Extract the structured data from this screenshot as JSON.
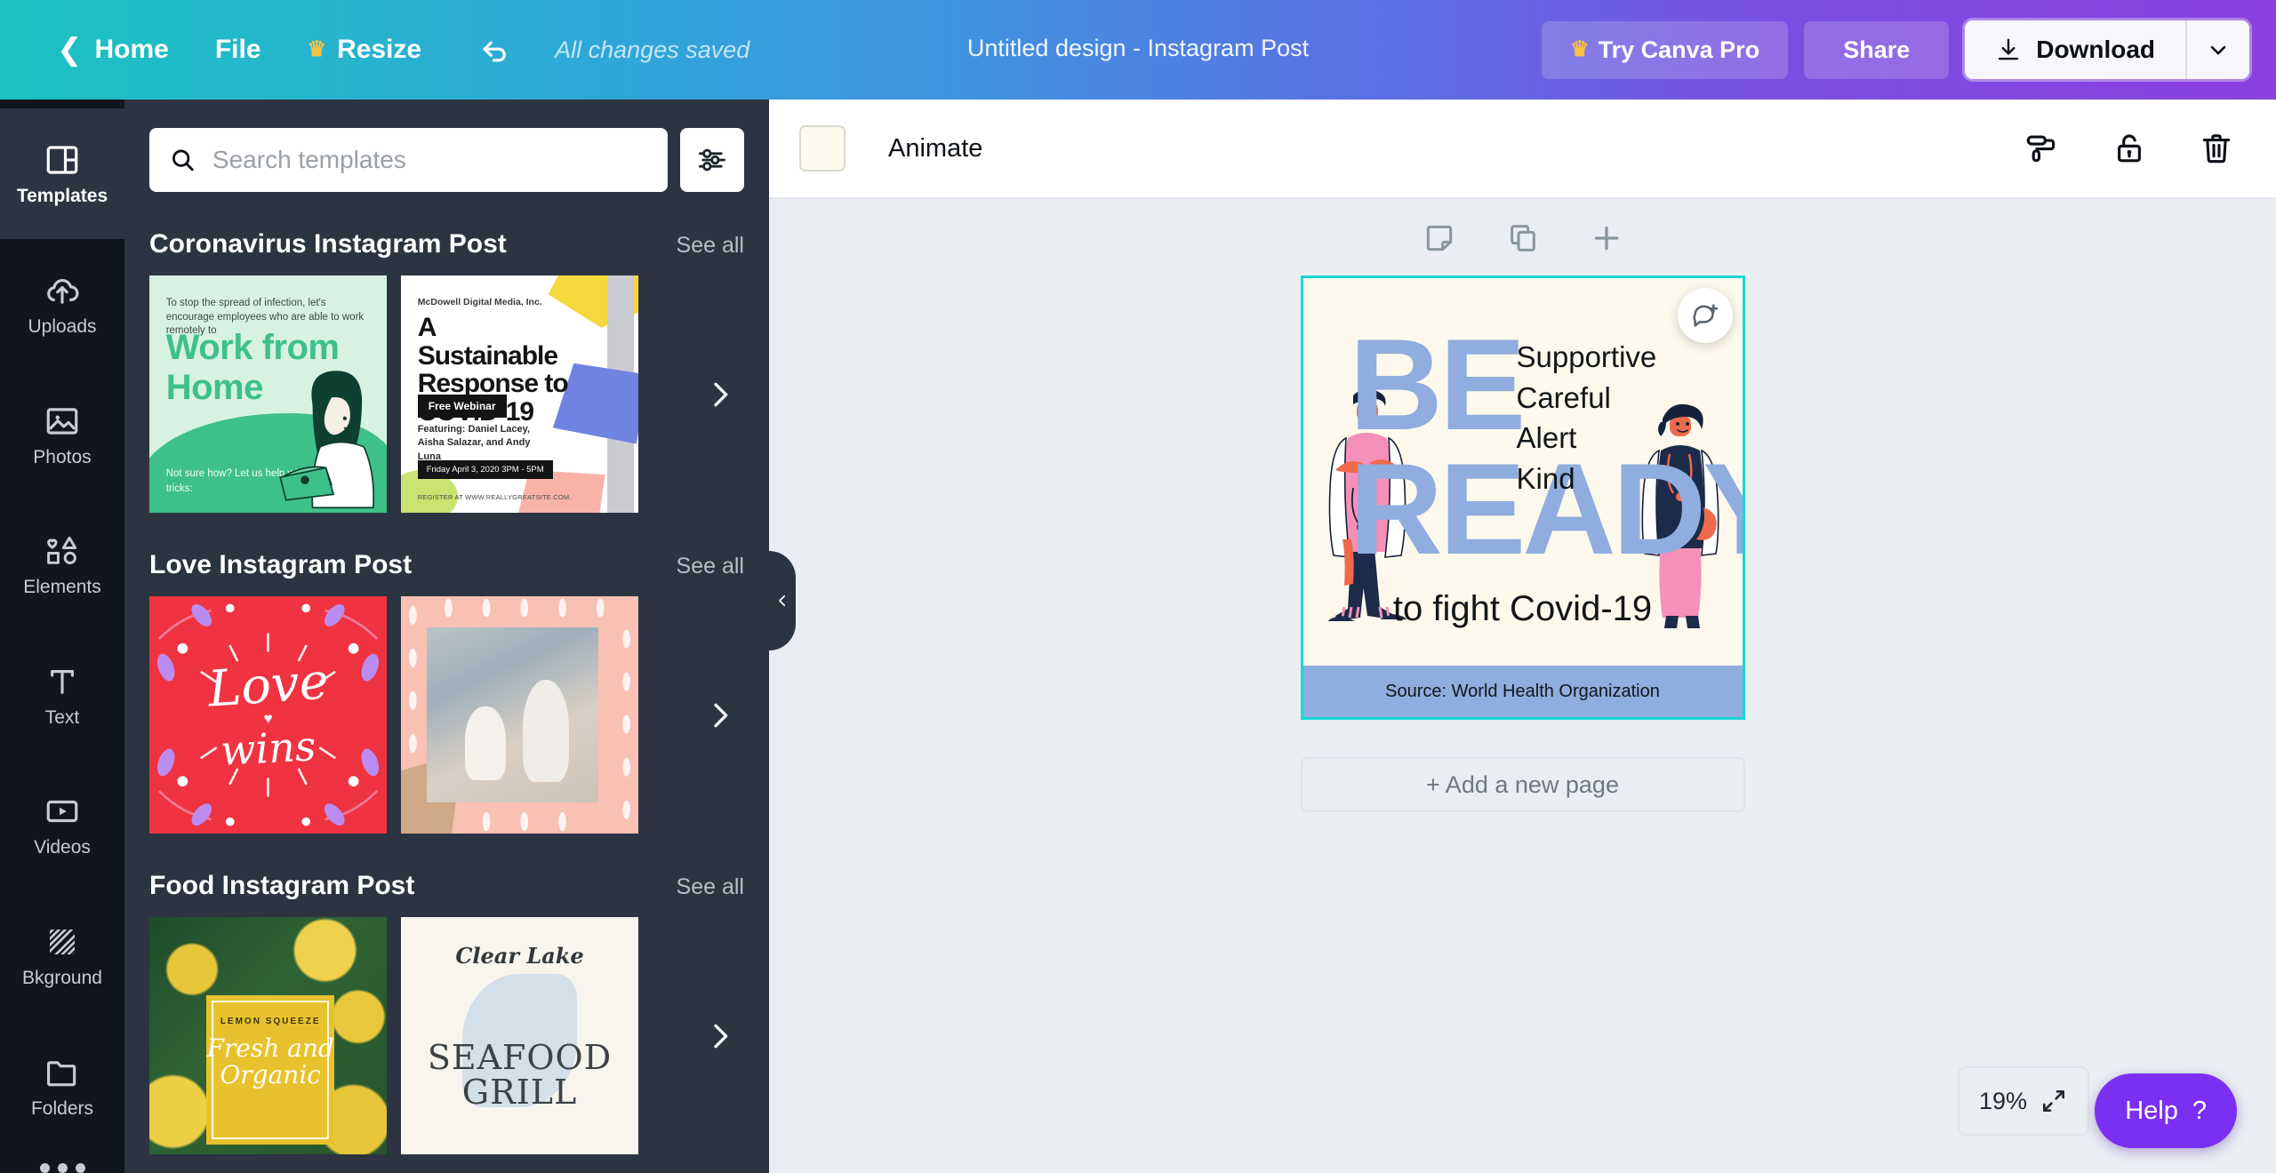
{
  "topbar": {
    "home": "Home",
    "file": "File",
    "resize": "Resize",
    "undo_icon": "undo-arrow-icon",
    "saved_status": "All changes saved",
    "design_title": "Untitled design - Instagram Post",
    "try_pro": "Try Canva Pro",
    "share": "Share",
    "download": "Download",
    "download_caret_icon": "chevron-down-icon",
    "crown_icon": "crown-icon",
    "back_icon": "chevron-left-icon"
  },
  "rail": {
    "items": [
      {
        "label": "Templates",
        "icon": "templates-icon",
        "active": true
      },
      {
        "label": "Uploads",
        "icon": "cloud-upload-icon",
        "active": false
      },
      {
        "label": "Photos",
        "icon": "image-icon",
        "active": false
      },
      {
        "label": "Elements",
        "icon": "shapes-icon",
        "active": false
      },
      {
        "label": "Text",
        "icon": "text-t-icon",
        "active": false
      },
      {
        "label": "Videos",
        "icon": "video-play-icon",
        "active": false
      },
      {
        "label": "Bkground",
        "icon": "hatch-pattern-icon",
        "active": false
      },
      {
        "label": "Folders",
        "icon": "folder-icon",
        "active": false
      }
    ],
    "more_icon": "more-dots-icon"
  },
  "panel": {
    "search": {
      "placeholder": "Search templates",
      "value": "",
      "search_icon": "search-icon",
      "filter_icon": "sliders-filter-icon"
    },
    "collapse_icon": "chevron-left-icon",
    "see_all_label": "See all",
    "next_icon": "chevron-right-icon",
    "sections": [
      {
        "title": "Coronavirus Instagram Post",
        "templates": [
          {
            "name": "work-from-home",
            "subtitle": "To stop the spread of infection, let's encourage employees who are able to work remotely to",
            "title": "Work from Home",
            "footer": "Not sure how? Let us help with a few tips and tricks:"
          },
          {
            "name": "sustainable-response",
            "brand": "McDowell Digital Media, Inc.",
            "title": "A Sustainable Response to COVID-19",
            "pill": "Free Webinar",
            "featuring": "Featuring: Daniel Lacey, Aisha Salazar, and Andy Luna",
            "date": "Friday April 3, 2020 3PM - 5PM",
            "register": "REGISTER AT WWW.REALLYGREATSITE.COM."
          }
        ]
      },
      {
        "title": "Love Instagram Post",
        "templates": [
          {
            "name": "love-wins",
            "word1": "Love",
            "word2": "wins",
            "heart": "♥"
          },
          {
            "name": "babies-photo"
          }
        ]
      },
      {
        "title": "Food Instagram Post",
        "templates": [
          {
            "name": "lemon-squeeze",
            "kicker": "LEMON SQUEEZE",
            "title": "Fresh and Organic"
          },
          {
            "name": "seafood-grill",
            "brand": "Clear Lake",
            "title": "SEAFOOD GRILL"
          }
        ]
      }
    ]
  },
  "editor": {
    "toolbar": {
      "color_swatch": "#fdfaee",
      "animate_label": "Animate",
      "paint_roller_icon": "paint-roller-icon",
      "lock_icon": "unlocked-padlock-icon",
      "trash_icon": "trash-can-icon"
    },
    "page_tools": {
      "notes_icon": "sticky-note-icon",
      "duplicate_icon": "duplicate-page-icon",
      "add_icon": "plus-icon"
    },
    "comment_icon": "add-comment-icon",
    "add_page_label": "+ Add a new page",
    "zoom_level": "19%",
    "expand_icon": "expand-arrows-icon",
    "help_label": "Help",
    "help_mark": "?"
  },
  "design": {
    "be": "BE",
    "ready": "READY",
    "keywords": [
      "Supportive",
      "Careful",
      "Alert",
      "Kind"
    ],
    "tagline": "to fight Covid-19",
    "source": "Source: World Health Organization",
    "colors": {
      "background": "#fdf8ec",
      "headline": "#8fadde",
      "band": "#8fadde",
      "selection": "#17d7d7"
    }
  }
}
